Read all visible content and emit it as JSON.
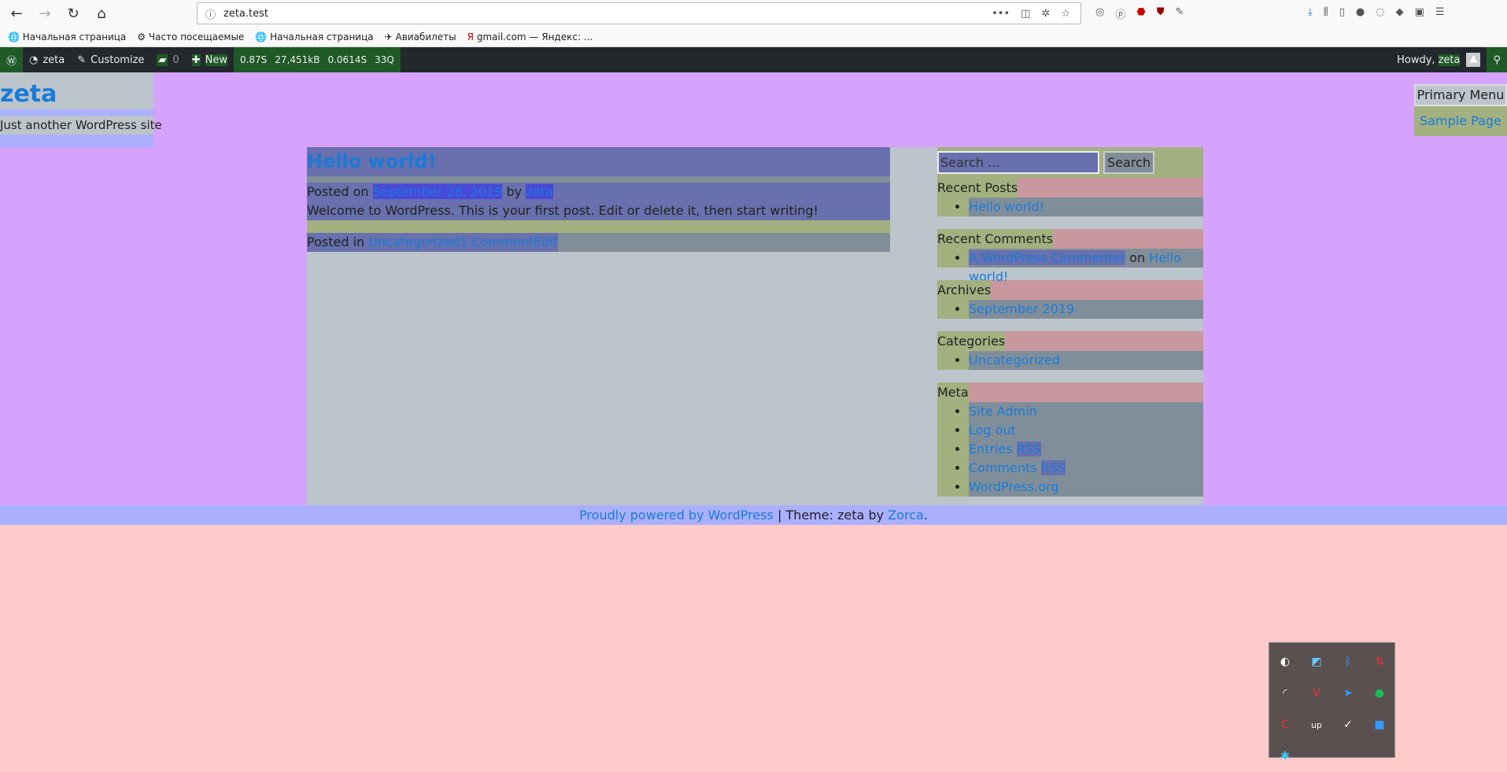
{
  "browser": {
    "url": "zeta.test",
    "bookmarks": [
      "Начальная страница",
      "Часто посещаемые",
      "Начальная страница",
      "Авиабилеты",
      "gmail.com — Яндекс: ..."
    ]
  },
  "adminbar": {
    "site": "zeta",
    "customize": "Customize",
    "comments": "0",
    "new": "New",
    "time": "0.87S",
    "memory": "27,451kB",
    "db_time": "0.0614S",
    "queries": "33Q",
    "howdy": "Howdy,",
    "user": "zeta"
  },
  "header": {
    "title": "zeta",
    "tagline": "Just another WordPress site",
    "menu_button": "Primary Menu",
    "menu_item": "Sample Page"
  },
  "post": {
    "title": "Hello world!",
    "posted_on": "Posted on",
    "date": "September 28, 2019",
    "by": "by",
    "author": "zeta",
    "body": "Welcome to WordPress. This is your first post. Edit or delete it, then start writing!",
    "posted_in": "Posted in",
    "category": "Uncategorized",
    "comments": "1 Comment",
    "edit": "Edit"
  },
  "sidebar": {
    "search_placeholder": "Search …",
    "search_button": "Search",
    "recent_posts": {
      "title": "Recent Posts",
      "items": [
        "Hello world!"
      ]
    },
    "recent_comments": {
      "title": "Recent Comments",
      "author": "A WordPress Commenter",
      "on": "on",
      "post": "Hello world!"
    },
    "archives": {
      "title": "Archives",
      "items": [
        "September 2019"
      ]
    },
    "categories": {
      "title": "Categories",
      "items": [
        "Uncategorized"
      ]
    },
    "meta": {
      "title": "Meta",
      "site_admin": "Site Admin",
      "log_out": "Log out",
      "entries": "Entries",
      "comments": "Comments",
      "rss": "RSS",
      "wporg": "WordPress.org"
    }
  },
  "footer": {
    "powered": "Proudly powered by WordPress",
    "sep": "|",
    "theme": "Theme: zeta by",
    "author": "Zorca",
    "end": "."
  }
}
